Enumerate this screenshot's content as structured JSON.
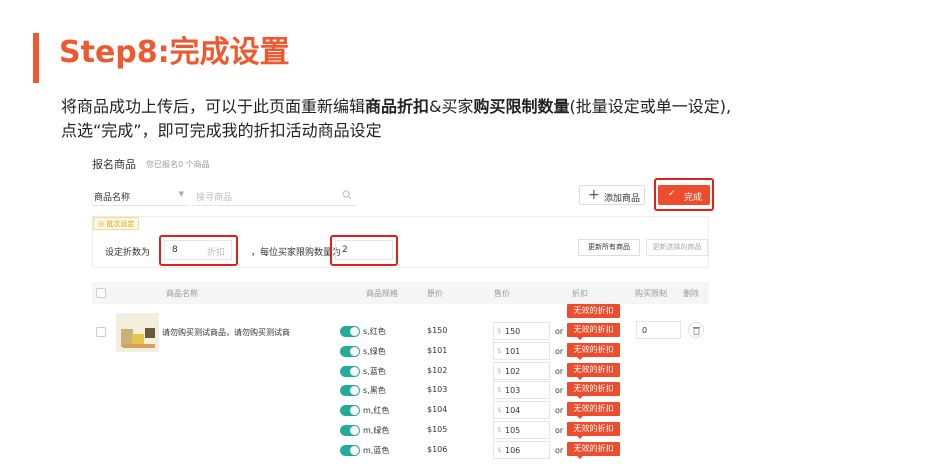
{
  "step_title": "Step8:完成设置",
  "description": {
    "line1_a": "将商品成功上传后，可以于此页面重新编辑",
    "line1_b": "商品折扣",
    "line1_c": "&买家",
    "line1_d": "购买限制数量",
    "line1_e": "(批量设定或单一设定),",
    "line2": "点选“完成”，即可完成我的折扣活动商品设定"
  },
  "panel": {
    "title": "报名商品",
    "subtitle": "您已报名0 个商品",
    "search_select": "商品名称",
    "search_placeholder": "搜寻商品",
    "add_button": "添加商品",
    "done_button": "完成",
    "batch_tag": "批次设定",
    "set_discount_label": "设定折数为",
    "discount_value": "8",
    "discount_unit": "折扣",
    "limit_label": "，每位买家限购数量为",
    "limit_value": "2",
    "update_all": "更新所有商品",
    "update_selected": "更新选择的商品"
  },
  "table": {
    "headers": {
      "name": "商品名称",
      "spec": "商品规格",
      "price": "原价",
      "sale": "售价",
      "discount": "折扣",
      "limit": "购买限制",
      "delete": "删除"
    },
    "product_name": "请勿购买测试商品，请勿购买测试商",
    "invalid_badge": "无效的折扣",
    "or_label": "or",
    "currency": "$",
    "limit_value": "0",
    "variants": [
      {
        "name": "s,红色",
        "price": "$150",
        "sale": "150"
      },
      {
        "name": "s,绿色",
        "price": "$101",
        "sale": "101"
      },
      {
        "name": "s,蓝色",
        "price": "$102",
        "sale": "102"
      },
      {
        "name": "s,黑色",
        "price": "$103",
        "sale": "103"
      },
      {
        "name": "m,红色",
        "price": "$104",
        "sale": "104"
      },
      {
        "name": "m,绿色",
        "price": "$105",
        "sale": "105"
      },
      {
        "name": "m,蓝色",
        "price": "$106",
        "sale": "106"
      }
    ]
  },
  "colors": {
    "accent": "#ee5a2f",
    "button": "#ee4d2d",
    "highlight": "#e0201a",
    "toggle": "#26aa99"
  }
}
